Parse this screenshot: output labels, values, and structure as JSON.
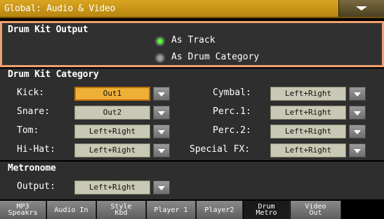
{
  "window": {
    "title": "Global: Audio & Video"
  },
  "drum_kit_output": {
    "title": "Drum Kit Output",
    "options": [
      {
        "label": "As Track",
        "selected": true
      },
      {
        "label": "As Drum Category",
        "selected": false
      }
    ]
  },
  "drum_kit_category": {
    "title": "Drum Kit Category",
    "left": [
      {
        "label": "Kick:",
        "value": "Out1"
      },
      {
        "label": "Snare:",
        "value": "Out2"
      },
      {
        "label": "Tom:",
        "value": "Left+Right"
      },
      {
        "label": "Hi-Hat:",
        "value": "Left+Right"
      }
    ],
    "right": [
      {
        "label": "Cymbal:",
        "value": "Left+Right"
      },
      {
        "label": "Perc.1:",
        "value": "Left+Right"
      },
      {
        "label": "Perc.2:",
        "value": "Left+Right"
      },
      {
        "label": "Special FX:",
        "value": "Left+Right"
      }
    ]
  },
  "metronome": {
    "title": "Metronome",
    "output_label": "Output:",
    "output_value": "Left+Right"
  },
  "tabs": [
    {
      "label": "MP3\nSpeakrs"
    },
    {
      "label": "Audio In"
    },
    {
      "label": "Style\nKbd"
    },
    {
      "label": "Player 1"
    },
    {
      "label": "Player2"
    },
    {
      "label": "Drum\nMetro",
      "active": true
    },
    {
      "label": "Video\nOut"
    }
  ],
  "colors": {
    "accent": "#d9a521",
    "selected_field": "#f0b038",
    "field": "#c8c8b4",
    "radio_on": "#5cff3c"
  }
}
